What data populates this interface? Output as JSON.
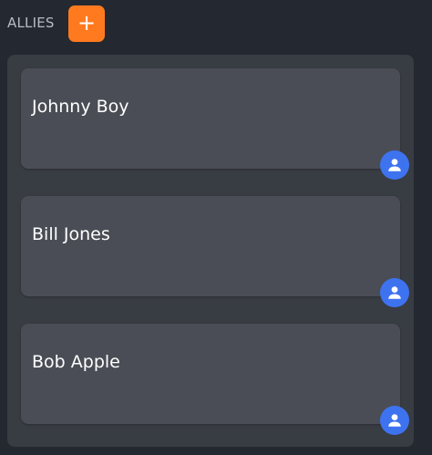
{
  "header": {
    "title": "ALLIES",
    "add_label": "+"
  },
  "allies": [
    {
      "name": "Johnny Boy"
    },
    {
      "name": "Bill Jones"
    },
    {
      "name": "Bob Apple"
    }
  ],
  "colors": {
    "background": "#232831",
    "panel": "#383c43",
    "card": "#4a4d55",
    "accent": "#ff7a1f",
    "avatar": "#3e73f0"
  },
  "icons": {
    "avatar": "person-icon"
  }
}
